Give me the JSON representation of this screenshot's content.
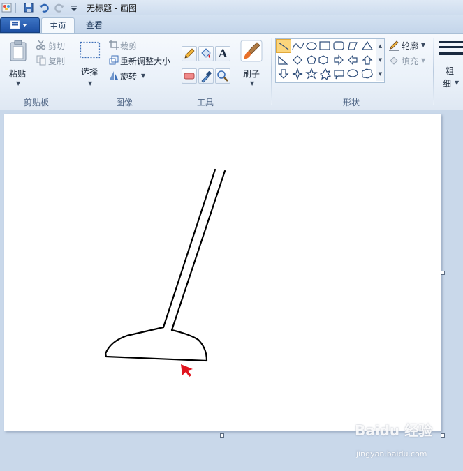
{
  "window": {
    "title": "无标题 - 画图"
  },
  "tabs": [
    {
      "label": "主页",
      "active": true
    },
    {
      "label": "查看",
      "active": false
    }
  ],
  "ribbon": {
    "clipboard": {
      "group_label": "剪贴板",
      "paste": "粘贴",
      "cut": "剪切",
      "copy": "复制"
    },
    "image": {
      "group_label": "图像",
      "select": "选择",
      "crop": "裁剪",
      "resize": "重新调整大小",
      "rotate": "旋转"
    },
    "tools": {
      "group_label": "工具",
      "text_glyph": "A"
    },
    "brushes": {
      "label": "刷子"
    },
    "shapes": {
      "group_label": "形状",
      "outline": "轮廓",
      "fill": "填充"
    },
    "size": {
      "label_line1": "粗",
      "label_line2": "细"
    }
  },
  "watermark": {
    "brand": "Baidu 经验",
    "url": "jingyan.baidu.com"
  },
  "colors": {
    "accent_selected": "#fbd57c",
    "app_menu": "#1d4fa3",
    "cursor_red": "#e0141e",
    "workspace": "#c9d8ea"
  },
  "icons": [
    "paint-app-icon",
    "save-icon",
    "undo-icon",
    "redo-icon",
    "customize-qat-icon",
    "app-menu-icon",
    "paste-icon",
    "cut-icon",
    "copy-icon",
    "select-icon",
    "crop-icon",
    "resize-icon",
    "rotate-icon",
    "pencil-icon",
    "fill-bucket-icon",
    "text-icon",
    "eraser-icon",
    "color-picker-icon",
    "magnifier-icon",
    "brush-icon",
    "outline-icon",
    "fill-icon",
    "size-icon",
    "arrow-cursor-icon"
  ]
}
